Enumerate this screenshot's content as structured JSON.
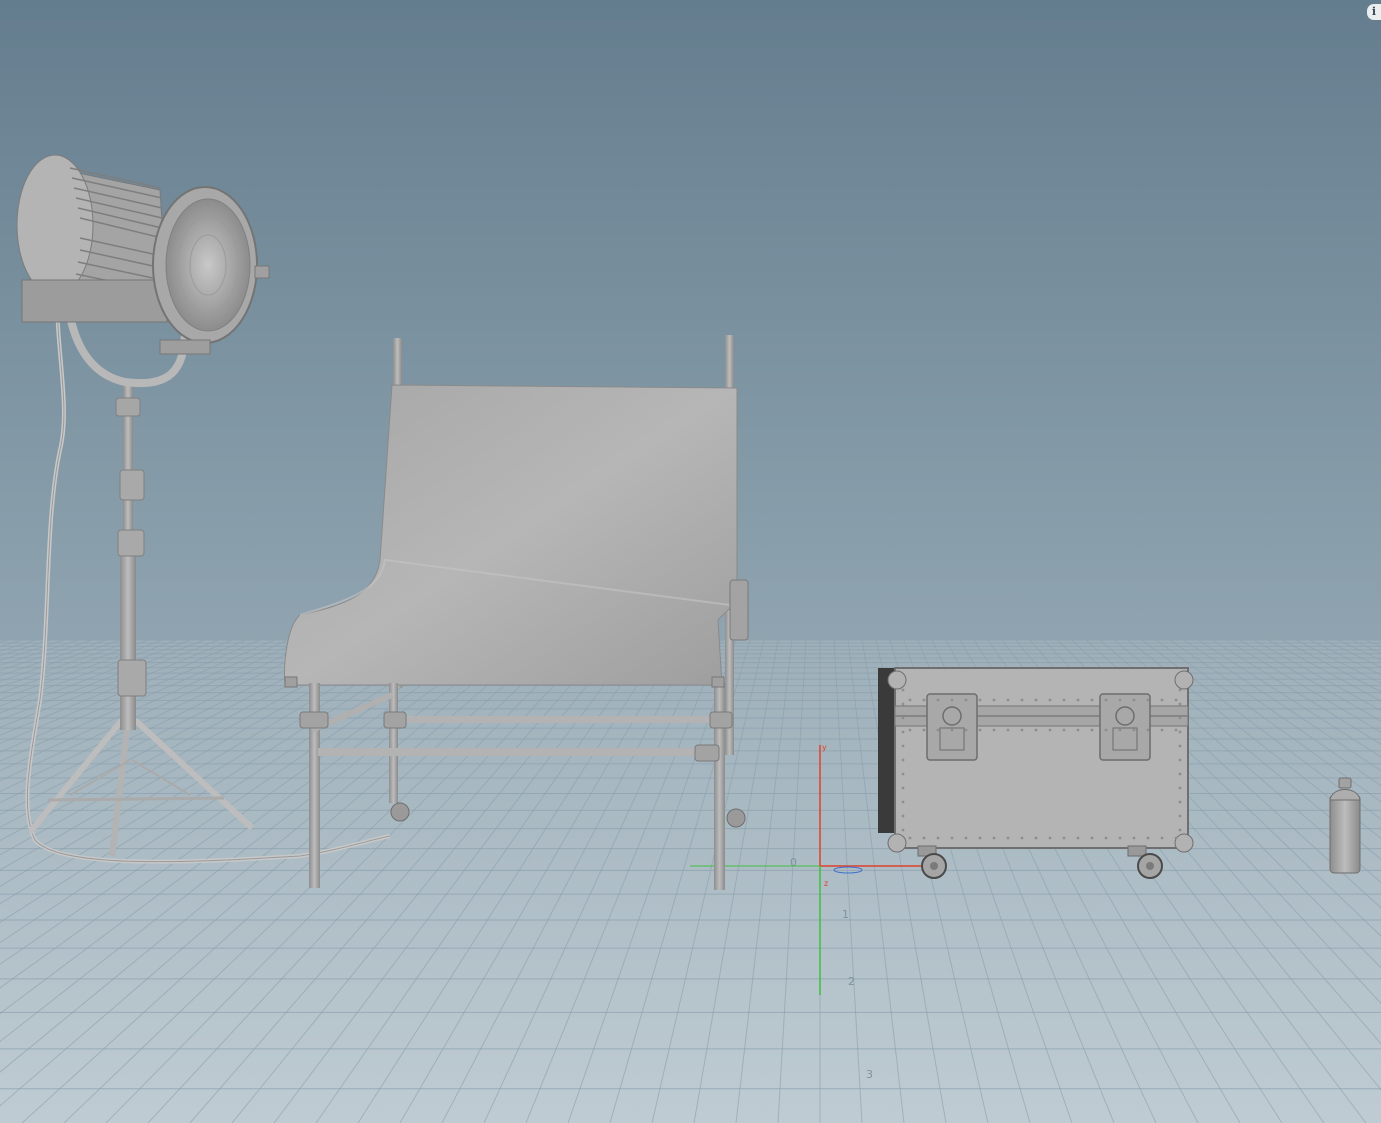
{
  "viewport": {
    "background_top": "#667f8f",
    "background_mid": "#8ea3b0",
    "background_bottom": "#b5c3cb",
    "grid_color": "#8aa0ad",
    "info_icon": "i"
  },
  "axis": {
    "x_color": "#e0402a",
    "y_color": "#3fbf3f",
    "z_color": "#3a6fd0",
    "x_label": "x",
    "y_label": "y",
    "z_label": "z"
  },
  "grid_labels": [
    "0",
    "1",
    "2",
    "3"
  ],
  "objects": [
    "fresnel-light-on-stand",
    "shooting-table",
    "flight-case",
    "spray-can"
  ]
}
